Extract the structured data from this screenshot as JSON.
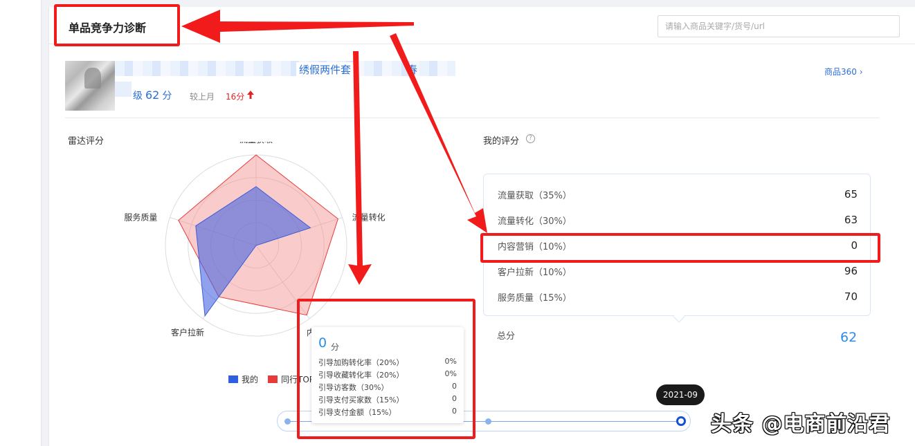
{
  "header": {
    "title": "单品竞争力诊断",
    "search_placeholder": "请输入商品关键字/货号/url"
  },
  "product": {
    "title_visible": "绣假两件套",
    "title_tail": "春",
    "level_prefix": "级",
    "score": "62",
    "score_unit": "分",
    "compare_label": "较上月",
    "delta": "16分",
    "link": "商品360 ›"
  },
  "sections": {
    "radar_title": "雷达评分",
    "my_score_title": "我的评分",
    "help_icon": "?"
  },
  "chart_data": {
    "type": "radar",
    "axes": [
      "流量获取",
      "流量转化",
      "内容营销",
      "客户拉新",
      "服务质量"
    ],
    "series": [
      {
        "name": "我的",
        "values": [
          65,
          63,
          0,
          96,
          70
        ],
        "color": "#4a6fe0"
      },
      {
        "name": "同行TOP",
        "values": [
          100,
          95,
          95,
          70,
          90
        ],
        "color": "#f3a6a6"
      }
    ],
    "max": 100,
    "rings": 4
  },
  "legend": {
    "mine": "我的",
    "top": "同行TOP"
  },
  "scores": [
    {
      "label": "流量获取（35%）",
      "value": "65"
    },
    {
      "label": "流量转化（30%）",
      "value": "63"
    },
    {
      "label": "内容营销（10%）",
      "value": "0"
    },
    {
      "label": "客户拉新（10%）",
      "value": "96"
    },
    {
      "label": "服务质量（15%）",
      "value": "70"
    }
  ],
  "total": {
    "label": "总分",
    "value": "62"
  },
  "tooltip": {
    "score": "0",
    "unit": "分",
    "rows": [
      {
        "label": "引导加购转化率（20%）",
        "value": "0%"
      },
      {
        "label": "引导收藏转化率（20%）",
        "value": "0%"
      },
      {
        "label": "引导访客数（30%）",
        "value": "0"
      },
      {
        "label": "引导支付买家数（15%）",
        "value": "0"
      },
      {
        "label": "引导支付金额（15%）",
        "value": "0"
      }
    ]
  },
  "timeline": {
    "selected": "2021-09"
  },
  "watermark": "头条 @电商前沿君",
  "colors": {
    "accent": "#2b8cf0",
    "link": "#2b6fd6",
    "alert": "#f21b1b"
  }
}
